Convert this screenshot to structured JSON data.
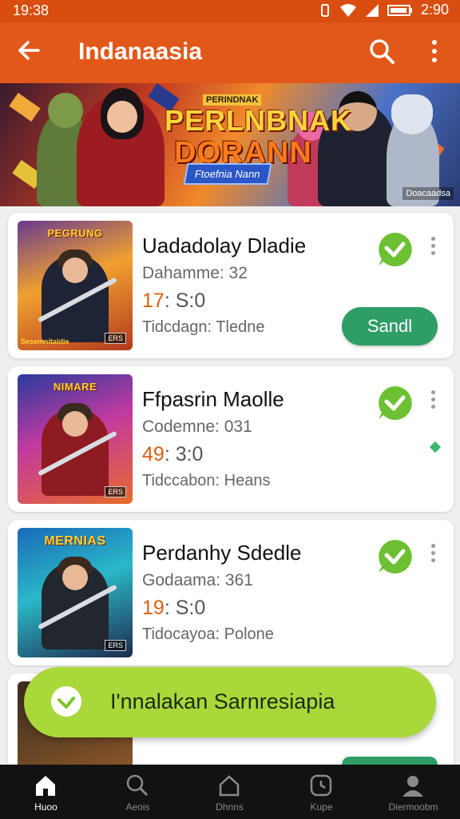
{
  "status_bar": {
    "time": "19:38",
    "battery_text": "2:90"
  },
  "app_bar": {
    "title": "Indanaasia"
  },
  "banner": {
    "top_label": "PERINDNAK",
    "title_line1": "PERLNBNAK",
    "title_line2": "DORANN",
    "tagline": "Ftoefnia Nann",
    "corner": "Doacaadsa"
  },
  "cards": [
    {
      "thumb_logo": "PEGRUNG",
      "thumb_bottom": "Sesemnitaldie",
      "thumb_corner": "ERS",
      "title": "Uadadolay Dladie",
      "subtitle": "Dahamme: 32",
      "time_highlight": "17",
      "time_rest": ": S:0",
      "footer": "Tidcdagn: Tledne",
      "button": "Sandl"
    },
    {
      "thumb_logo": "NIMARE",
      "thumb_corner": "ERS",
      "title": "Ffpasrin Maolle",
      "subtitle": "Codemne: 031",
      "time_highlight": "49",
      "time_rest": ": 3:0",
      "footer": "Tidccabon: Heans"
    },
    {
      "thumb_logo": "MERNIAS",
      "thumb_corner": "ERS",
      "title": "Perdanhy Sdedle",
      "subtitle": "Godaama: 361",
      "time_highlight": "19",
      "time_rest": ": S:0",
      "footer": "Tidocayoa: Polone"
    }
  ],
  "toast": {
    "text": "I'nnalakan Sarnresiapia"
  },
  "bottom_nav": [
    {
      "label": "Huoo"
    },
    {
      "label": "Aeois"
    },
    {
      "label": "Dhnns"
    },
    {
      "label": "Kupe"
    },
    {
      "label": "Diermoobm"
    }
  ],
  "colors": {
    "app_bar": "#e2581a",
    "accent_green": "#2e9e66",
    "toast": "#a8d83a",
    "check_green": "#6cc031"
  }
}
